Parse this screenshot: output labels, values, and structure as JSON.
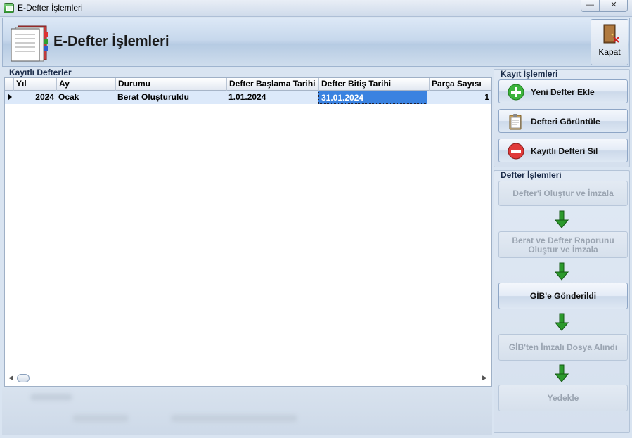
{
  "window": {
    "title": "E-Defter İşlemleri",
    "min_glyph": "—",
    "close_glyph": "✕"
  },
  "header": {
    "title": "E-Defter İşlemleri",
    "close_button_label": "Kapat"
  },
  "grid": {
    "group_label": "Kayıtlı Defterler",
    "columns": [
      "Yıl",
      "Ay",
      "Durumu",
      "Defter Başlama Tarihi",
      "Defter Bitiş Tarihi",
      "Parça Sayısı"
    ],
    "rows": [
      {
        "yil": "2024",
        "ay": "Ocak",
        "durumu": "Berat Oluşturuldu",
        "baslama": "1.01.2024",
        "bitis": "31.01.2024",
        "parca": "1"
      }
    ],
    "scroll_left": "◀",
    "scroll_right": "▶"
  },
  "kayit_islemleri": {
    "label": "Kayıt İşlemleri",
    "buttons": [
      {
        "label": "Yeni Defter Ekle",
        "icon": "add-icon"
      },
      {
        "label": "Defteri Görüntüle",
        "icon": "clipboard-icon"
      },
      {
        "label": "Kayıtlı Defteri Sil",
        "icon": "delete-icon"
      }
    ]
  },
  "defter_islemleri": {
    "label": "Defter İşlemleri",
    "steps": [
      {
        "label": "Defter'i Oluştur ve İmzala",
        "enabled": false
      },
      {
        "label_line1": "Berat ve Defter Raporunu",
        "label_line2": "Oluştur ve İmzala",
        "enabled": false
      },
      {
        "label": "GİB'e Gönderildi",
        "enabled": true
      },
      {
        "label": "GİB'ten İmzalı Dosya Alındı",
        "enabled": false
      },
      {
        "label": "Yedekle",
        "enabled": false
      }
    ]
  },
  "colors": {
    "selection": "#3a82e0",
    "row_highlight": "#dce9fa",
    "arrow_green": "#2c9a2c"
  }
}
